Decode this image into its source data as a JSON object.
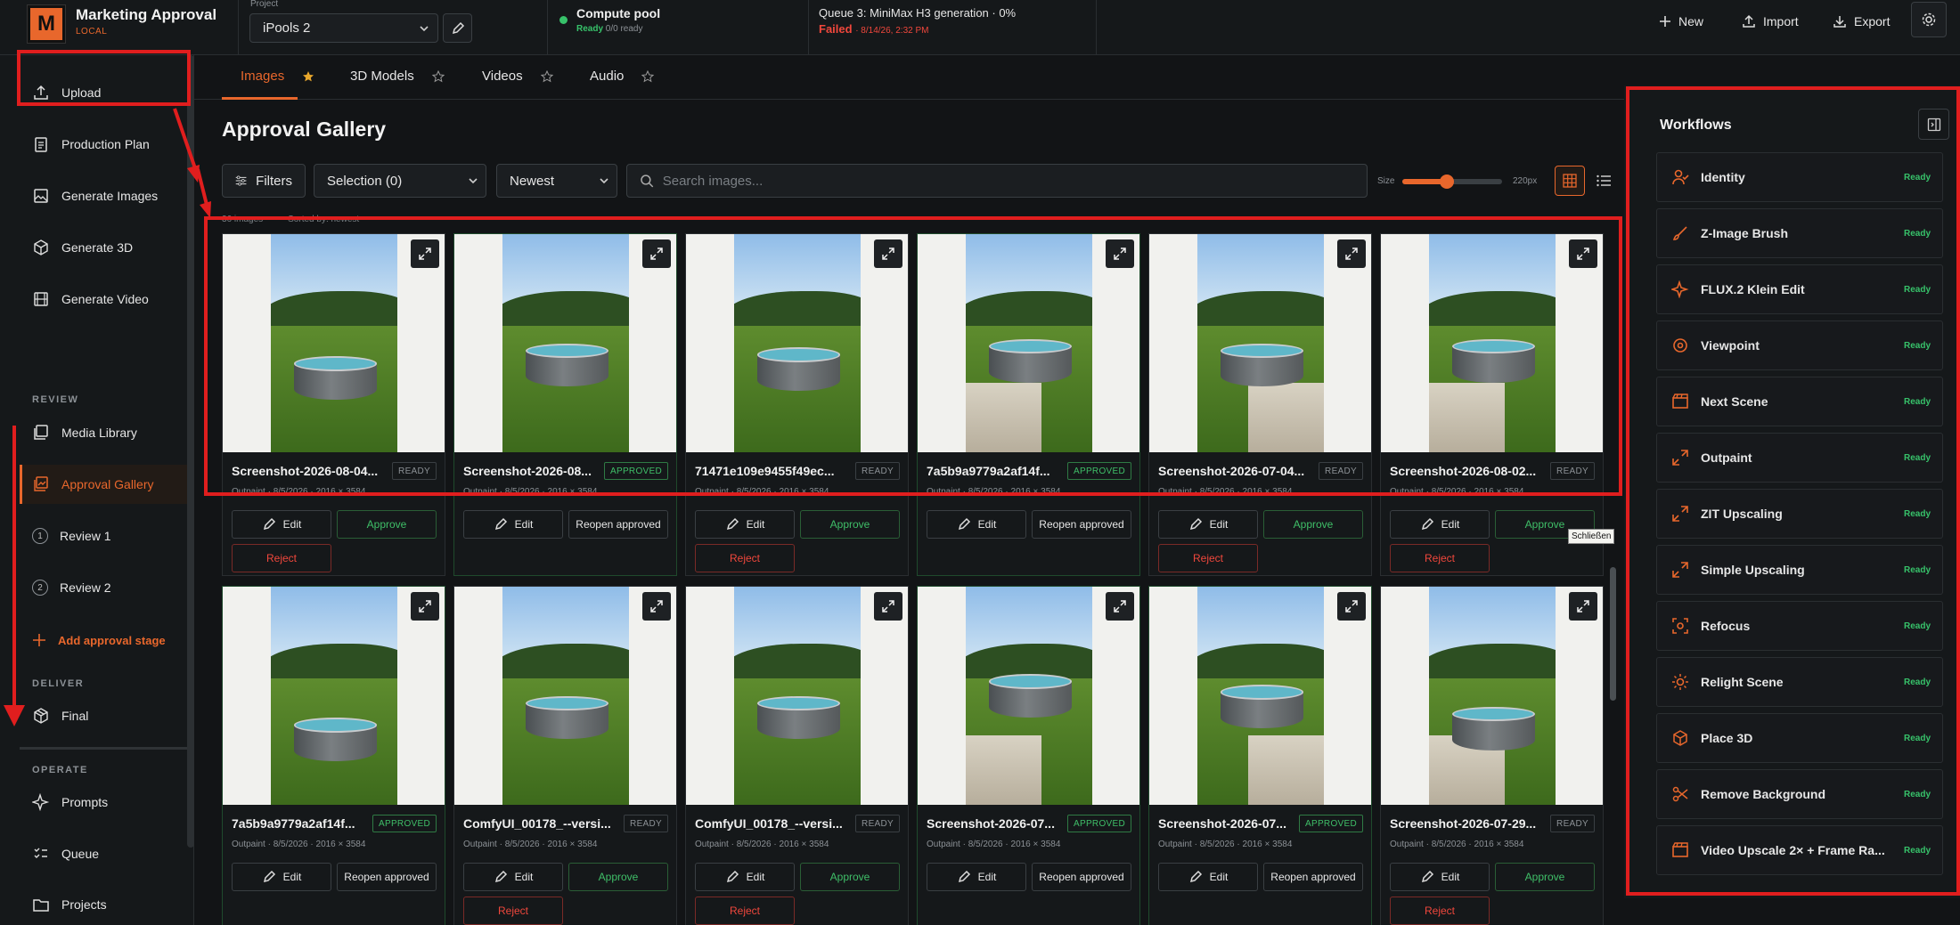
{
  "app": {
    "logo_letter": "M",
    "title": "Marketing Approval",
    "subtitle": "LOCAL"
  },
  "project": {
    "label": "Project",
    "value": "iPools 2"
  },
  "compute": {
    "title": "Compute pool",
    "status": "Ready",
    "detail": "0/0 ready"
  },
  "queue": {
    "title": "Queue 3: MiniMax H3 generation · 0%",
    "status": "Failed",
    "time": "· 8/14/26, 2:32 PM"
  },
  "topbar": {
    "new_label": "New",
    "import_label": "Import",
    "export_label": "Export"
  },
  "sidebar": {
    "items": [
      {
        "label": "Upload",
        "icon": "upload-icon"
      },
      {
        "label": "Production Plan",
        "icon": "clipboard-icon"
      },
      {
        "label": "Generate Images",
        "icon": "image-icon"
      },
      {
        "label": "Generate 3D",
        "icon": "cube-icon"
      },
      {
        "label": "Generate Video",
        "icon": "film-icon"
      }
    ],
    "review_section": "REVIEW",
    "review_items": [
      {
        "label": "Media Library"
      },
      {
        "label": "Approval Gallery"
      },
      {
        "label": "Review 1",
        "num": "1"
      },
      {
        "label": "Review 2",
        "num": "2"
      }
    ],
    "add_stage": "Add approval stage",
    "deliver_section": "DELIVER",
    "final": "Final",
    "operate_section": "OPERATE",
    "operate_items": [
      {
        "label": "Prompts"
      },
      {
        "label": "Queue"
      },
      {
        "label": "Projects"
      }
    ]
  },
  "tabs": [
    {
      "label": "Images"
    },
    {
      "label": "3D Models"
    },
    {
      "label": "Videos"
    },
    {
      "label": "Audio"
    }
  ],
  "main": {
    "title": "Approval Gallery",
    "filters_label": "Filters",
    "selection_label": "Selection (0)",
    "sort_label": "Newest",
    "search_placeholder": "Search images...",
    "size_label": "Size",
    "size_value": "220px",
    "size_fraction": 0.45,
    "count_text": "36 images",
    "sorted_text": "Sorted by: newest"
  },
  "actions": {
    "edit": "Edit",
    "approve": "Approve",
    "reject": "Reject",
    "reopen": "Reopen approved"
  },
  "cards": [
    {
      "name": "Screenshot-2026-08-04...",
      "status": "READY",
      "meta": "Outpaint · 8/5/2026 · 2016 × 3584"
    },
    {
      "name": "Screenshot-2026-08...",
      "status": "APPROVED",
      "meta": "Outpaint · 8/5/2026 · 2016 × 3584"
    },
    {
      "name": "71471e109e9455f49ec...",
      "status": "READY",
      "meta": "Outpaint · 8/5/2026 · 2016 × 3584"
    },
    {
      "name": "7a5b9a9779a2af14f...",
      "status": "APPROVED",
      "meta": "Outpaint · 8/5/2026 · 2016 × 3584"
    },
    {
      "name": "Screenshot-2026-07-04...",
      "status": "READY",
      "meta": "Outpaint · 8/5/2026 · 2016 × 3584"
    },
    {
      "name": "Screenshot-2026-08-02...",
      "status": "READY",
      "meta": "Outpaint · 8/5/2026 · 2016 × 3584"
    },
    {
      "name": "7a5b9a9779a2af14f...",
      "status": "APPROVED",
      "meta": "Outpaint · 8/5/2026 · 2016 × 3584"
    },
    {
      "name": "ComfyUI_00178_--versi...",
      "status": "READY",
      "meta": "Outpaint · 8/5/2026 · 2016 × 3584"
    },
    {
      "name": "ComfyUI_00178_--versi...",
      "status": "READY",
      "meta": "Outpaint · 8/5/2026 · 2016 × 3584"
    },
    {
      "name": "Screenshot-2026-07...",
      "status": "APPROVED",
      "meta": "Outpaint · 8/5/2026 · 2016 × 3584"
    },
    {
      "name": "Screenshot-2026-07...",
      "status": "APPROVED",
      "meta": "Outpaint · 8/5/2026 · 2016 × 3584"
    },
    {
      "name": "Screenshot-2026-07-29...",
      "status": "READY",
      "meta": "Outpaint · 8/5/2026 · 2016 × 3584"
    }
  ],
  "tooltip": "Schließen",
  "workflows": {
    "title": "Workflows",
    "items": [
      {
        "name": "Identity",
        "status": "Ready",
        "icon": "person-icon"
      },
      {
        "name": "Z-Image Brush",
        "status": "Ready",
        "icon": "brush-icon"
      },
      {
        "name": "FLUX.2 Klein Edit",
        "status": "Ready",
        "icon": "sparkle-icon"
      },
      {
        "name": "Viewpoint",
        "status": "Ready",
        "icon": "viewpoint-icon"
      },
      {
        "name": "Next Scene",
        "status": "Ready",
        "icon": "clapper-icon"
      },
      {
        "name": "Outpaint",
        "status": "Ready",
        "icon": "expand-icon"
      },
      {
        "name": "ZIT Upscaling",
        "status": "Ready",
        "icon": "expand-icon"
      },
      {
        "name": "Simple Upscaling",
        "status": "Ready",
        "icon": "expand-icon"
      },
      {
        "name": "Refocus",
        "status": "Ready",
        "icon": "focus-icon"
      },
      {
        "name": "Relight Scene",
        "status": "Ready",
        "icon": "sun-icon"
      },
      {
        "name": "Place 3D",
        "status": "Ready",
        "icon": "cube-icon"
      },
      {
        "name": "Remove Background",
        "status": "Ready",
        "icon": "scissors-icon"
      },
      {
        "name": "Video Upscale 2× + Frame Ra...",
        "status": "Ready",
        "icon": "clapper-icon"
      }
    ]
  },
  "colors": {
    "accent": "#e8672c",
    "ready": "#37c26a",
    "failed": "#f0473c",
    "annotation": "#e01e1e"
  }
}
